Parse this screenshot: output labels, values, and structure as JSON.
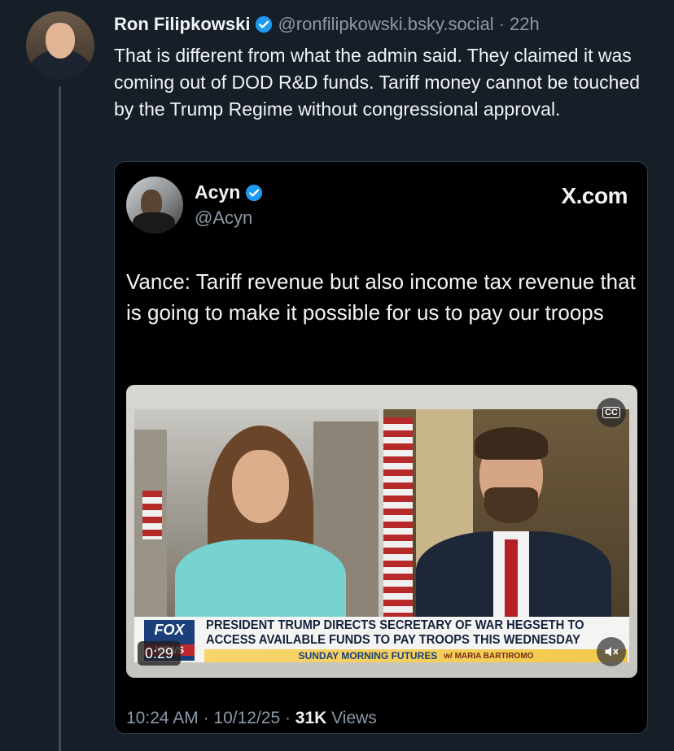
{
  "post": {
    "author_name": "Ron Filipkowski",
    "handle": "@ronfilipkowski.bsky.social",
    "separator": "·",
    "time": "22h",
    "text": "That is different from what the admin said. They claimed it was coming out of DOD R&D funds. Tariff money cannot be touched by the Trump Regime without congressional approval."
  },
  "embed": {
    "author_name": "Acyn",
    "handle": "@Acyn",
    "site_logo": "X.com",
    "text": "Vance: Tariff revenue but also income tax revenue that is going to make it possible for us to pay our troops",
    "video": {
      "headline_line1": "PRESIDENT TRUMP DIRECTS SECRETARY OF WAR HEGSETH TO",
      "headline_line2": "ACCESS AVAILABLE FUNDS TO PAY TROOPS THIS WEDNESDAY",
      "show_name": "SUNDAY MORNING FUTURES",
      "show_host": "w/ MARIA BARTIROMO",
      "network_logo": "FOX",
      "network_sub": "NEWS",
      "duration": "0:29",
      "cc_label": "CC"
    },
    "meta": {
      "timestamp": "10:24 AM · 10/12/25 · ",
      "views_count": "31K",
      "views_label": " Views"
    }
  },
  "colors": {
    "background": "#161e27",
    "accent_verified": "#1d9bf0",
    "muted_text": "#8c99a8"
  }
}
